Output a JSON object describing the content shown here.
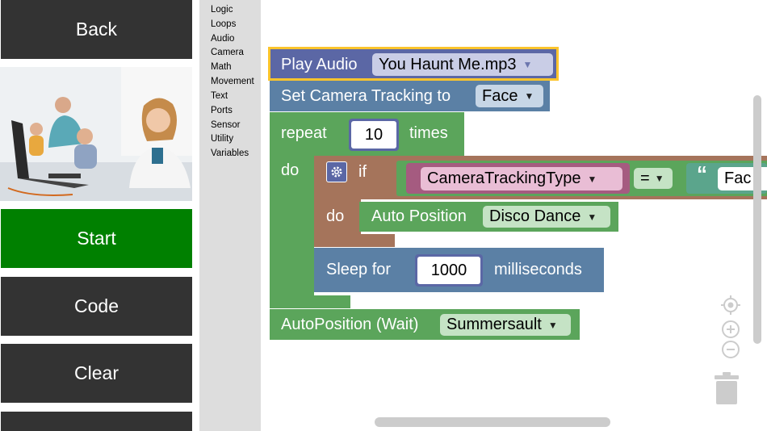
{
  "nav": {
    "back": "Back",
    "start": "Start",
    "code": "Code",
    "clear": "Clear"
  },
  "colors": {
    "nav_dark": "#333333",
    "nav_green": "#008000",
    "block_purple": "#5b67a5",
    "block_blue": "#5b80a5",
    "block_green": "#5ba55b",
    "block_brown": "#a5745b",
    "block_pink": "#a55b80",
    "highlight": "#fcc42c"
  },
  "toolbox": {
    "categories": [
      "Logic",
      "Loops",
      "Audio",
      "Camera",
      "Math",
      "Movement",
      "Text",
      "Ports",
      "Sensor",
      "Utility",
      "Variables"
    ]
  },
  "blocks": {
    "play_audio": {
      "label": "Play Audio",
      "value": "You Haunt Me.mp3"
    },
    "camera_tracking": {
      "label": "Set Camera Tracking to",
      "value": "Face"
    },
    "repeat": {
      "label": "repeat",
      "count": "10",
      "suffix": "times",
      "do": "do"
    },
    "if_block": {
      "label": "if",
      "do": "do"
    },
    "compare": {
      "left": "CameraTrackingType",
      "op": "=",
      "quote": "“",
      "right": "Fac"
    },
    "auto_position": {
      "label": "Auto Position",
      "value": "Disco Dance"
    },
    "sleep": {
      "label": "Sleep for",
      "value": "1000",
      "suffix": "milliseconds"
    },
    "auto_position_wait": {
      "label": "AutoPosition (Wait)",
      "value": "Summersault"
    }
  },
  "icons": {
    "dropdown": "▼",
    "gear": "gear-icon",
    "recenter": "crosshair-icon",
    "zoom_in": "zoom-in-icon",
    "zoom_out": "zoom-out-icon",
    "trash": "trash-icon"
  }
}
